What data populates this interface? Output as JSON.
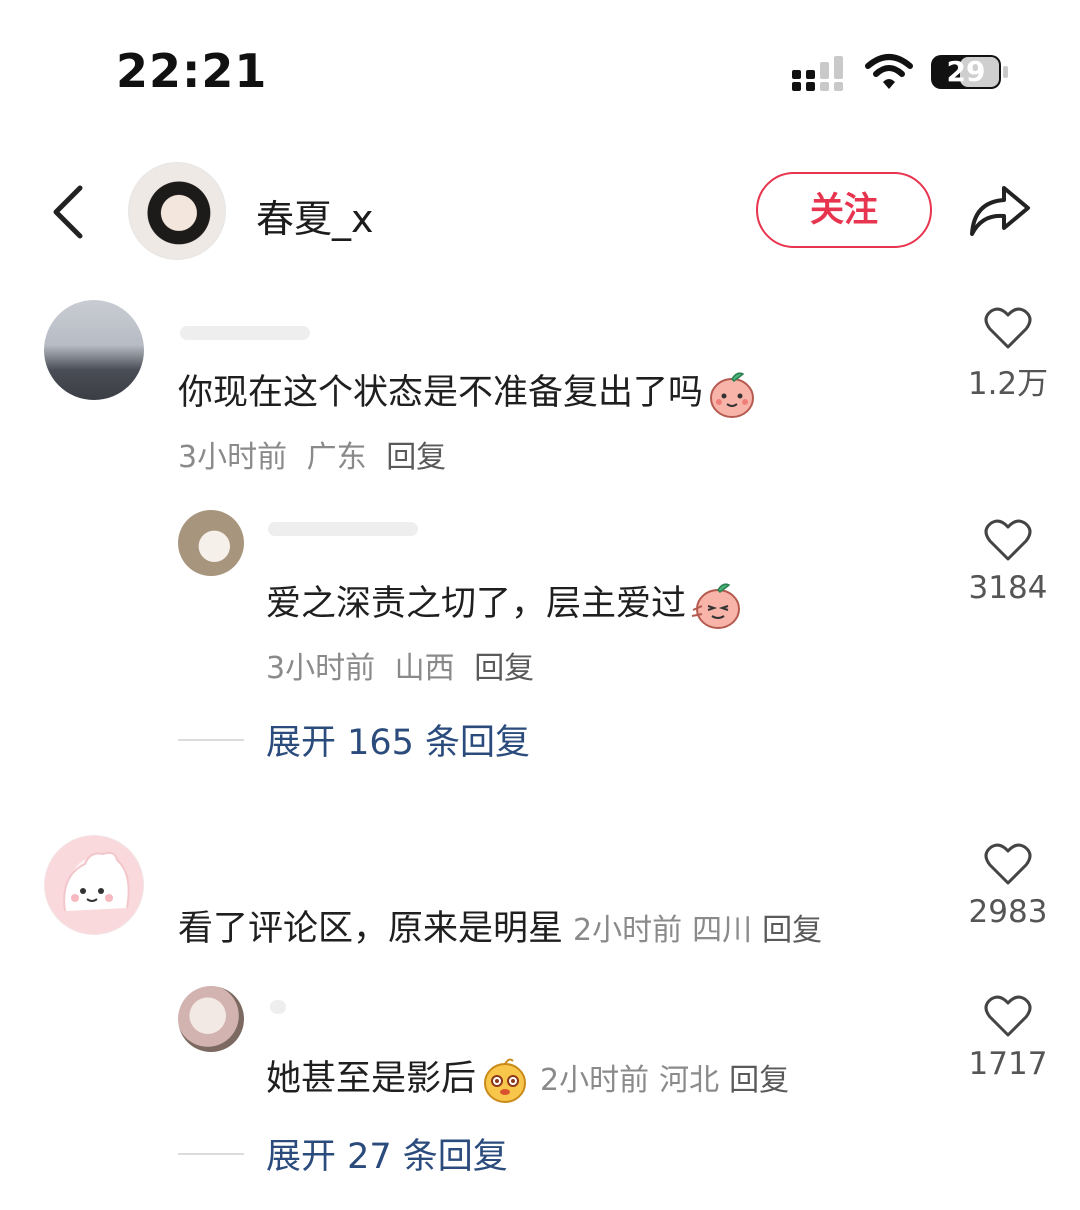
{
  "status_bar": {
    "time": "22:21",
    "battery": "29"
  },
  "header": {
    "username": "春夏_x",
    "follow_label": "关注"
  },
  "comments": [
    {
      "text": "你现在这个状态是不准备复出了吗",
      "emoji": "peach-smile-icon",
      "time": "3小时前",
      "location": "广东",
      "reply_label": "回复",
      "likes": "1.2万"
    },
    {
      "text": "爱之深责之切了，层主爱过",
      "emoji": "peach-wave-icon",
      "time": "3小时前",
      "location": "山西",
      "reply_label": "回复",
      "likes": "3184"
    },
    {
      "text": "看了评论区，原来是明星",
      "time": "2小时前",
      "location": "四川",
      "reply_label": "回复",
      "likes": "2983"
    },
    {
      "text": "她甚至是影后",
      "emoji": "gold-face-icon",
      "time": "2小时前",
      "location": "河北",
      "reply_label": "回复",
      "likes": "1717"
    }
  ],
  "expand_replies": [
    "展开 165 条回复",
    "展开 27 条回复"
  ],
  "colors": {
    "accent": "#e8354f",
    "link": "#2a4b7c",
    "meta": "#8a8a8a"
  }
}
